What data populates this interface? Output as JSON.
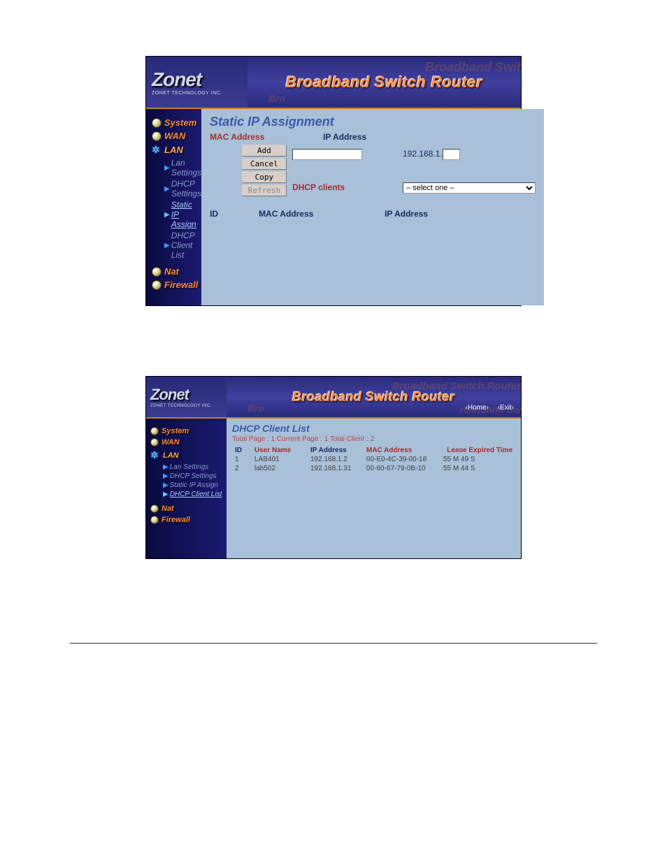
{
  "brand": {
    "logo": "Zonet",
    "tagline": "ZONET TECHNOLOGY INC.",
    "banner_title": "Broadband Switch Router",
    "ghost_text": "Broadband Swit",
    "ghost_text2": "Bro"
  },
  "header_links": {
    "home": "‹Home›",
    "exit": "‹Exit›"
  },
  "nav": {
    "system": "System",
    "wan": "WAN",
    "lan": "LAN",
    "nat": "Nat",
    "firewall": "Firewall",
    "sub": {
      "lan_settings": "Lan Settings",
      "dhcp_settings": "DHCP Settings",
      "static_ip_assign": "Static IP Assign",
      "dhcp_client_list": "DHCP Client List"
    }
  },
  "static_ip": {
    "title": "Static IP Assignment",
    "mac_label": "MAC Address",
    "ip_label": "IP Address",
    "ip_prefix": "192.168.1.",
    "dhcp_clients_label": "DHCP clients",
    "select_placeholder": "– select one –",
    "buttons": {
      "add": "Add",
      "cancel": "Cancel",
      "copy": "Copy",
      "refresh": "Refresh"
    },
    "list_headers": {
      "id": "ID",
      "mac": "MAC Address",
      "ip": "IP Address"
    }
  },
  "dhcp_list": {
    "title": "DHCP Client List",
    "summary": "Total Page : 1   Current Page : 1   Total Client : 2",
    "headers": {
      "id": "ID",
      "user": "User Name",
      "ip": "IP Address",
      "mac": "MAC Address",
      "lease": "Lease Expired Time"
    },
    "rows": [
      {
        "id": "1",
        "user": "LAB401",
        "ip": "192.168.1.2",
        "mac": "00-E0-4C-39-00-18",
        "lease": "55 M 49 S"
      },
      {
        "id": "2",
        "user": "lab502",
        "ip": "192.168.1.31",
        "mac": "00-60-67-79-0B-10",
        "lease": "55 M 44 S"
      }
    ]
  }
}
